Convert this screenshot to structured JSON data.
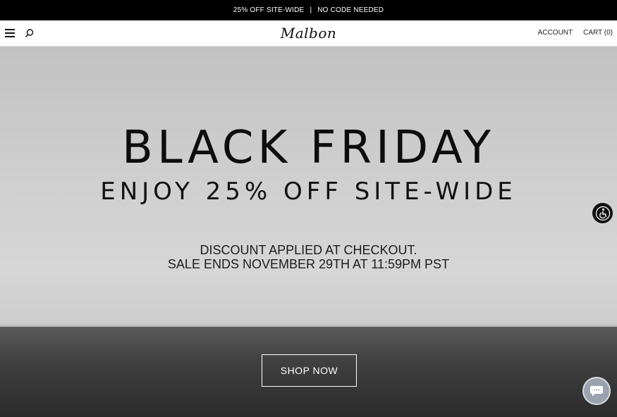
{
  "announcement": {
    "left": "25% OFF SITE-WIDE",
    "separator": "|",
    "right": "NO CODE NEEDED"
  },
  "header": {
    "logo": "Malbon",
    "account_label": "ACCOUNT",
    "cart_label": "CART (0)"
  },
  "hero": {
    "headline": "BLACK FRIDAY",
    "subheadline": "ENJOY 25% OFF SITE-WIDE",
    "line1": "DISCOUNT APPLIED AT CHECKOUT.",
    "line2": "SALE ENDS NOVEMBER 29TH AT 11:59PM PST",
    "cta_label": "SHOP NOW"
  },
  "icons": {
    "menu": "hamburger-icon",
    "search": "search-icon",
    "accessibility": "accessibility-icon",
    "chat": "chat-icon"
  },
  "colors": {
    "announcement_bg": "#000000",
    "chat_button": "#9aa3ad"
  }
}
